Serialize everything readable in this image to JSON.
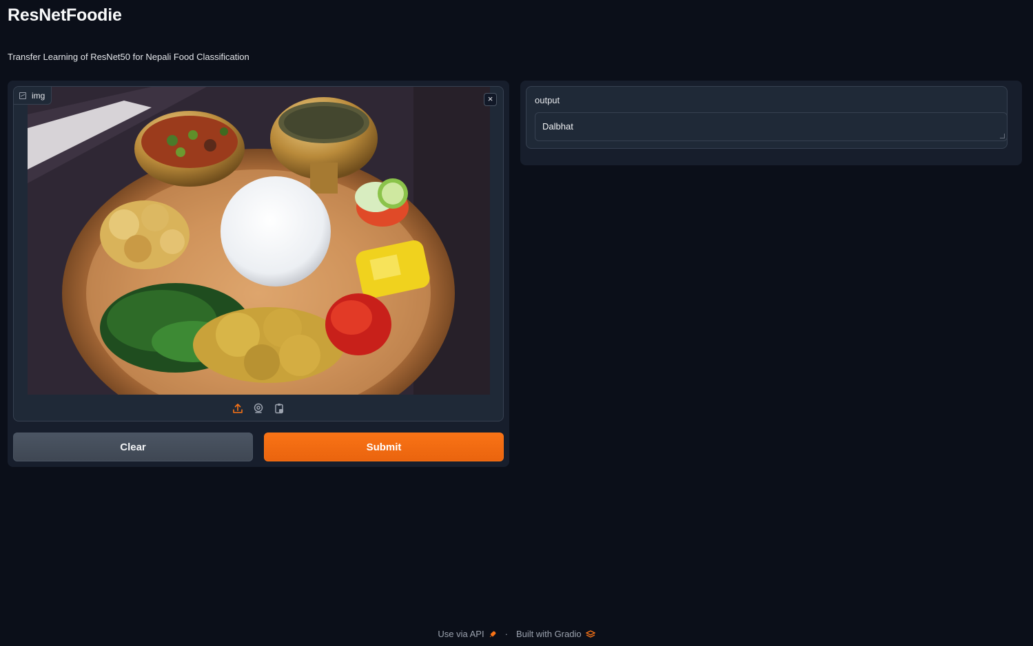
{
  "app": {
    "title": "ResNetFoodie",
    "description": "Transfer Learning of ResNet50 for Nepali Food Classification"
  },
  "input": {
    "label": "img",
    "label_icon": "image-icon",
    "close_icon": "close-icon",
    "close_glyph": "×",
    "sources": [
      {
        "name": "upload-icon",
        "active": true
      },
      {
        "name": "webcam-icon",
        "active": false
      },
      {
        "name": "clipboard-icon",
        "active": false
      }
    ]
  },
  "buttons": {
    "clear_label": "Clear",
    "submit_label": "Submit"
  },
  "output": {
    "label": "output",
    "value": "Dalbhat"
  },
  "footer": {
    "api_label": "Use via API",
    "separator": "·",
    "built_label": "Built with Gradio"
  },
  "colors": {
    "background": "#0b0f19",
    "panel": "#171e2c",
    "accent": "#f97316",
    "clear_button": "#4b5563"
  }
}
